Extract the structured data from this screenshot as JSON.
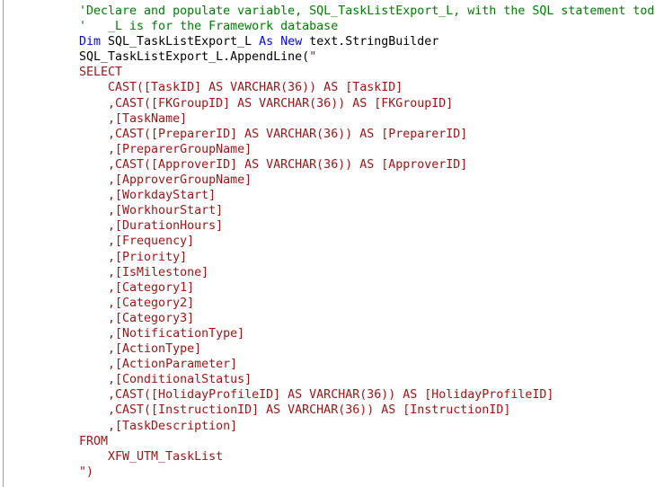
{
  "editor": {
    "language": "Visual Basic .NET",
    "background_color": "#ffffff",
    "margin_rule_color": "#9c9c9c",
    "colors": {
      "comment": "#008000",
      "keyword": "#0000ff",
      "identifier": "#000000",
      "string_literal": "#a31515"
    },
    "lines": [
      {
        "index": 1,
        "tokens": [
          {
            "type": "comment",
            "text": "'Declare and populate variable, SQL_TaskListExport_L, with the SQL statement today."
          }
        ]
      },
      {
        "index": 2,
        "tokens": [
          {
            "type": "comment",
            "text": "'   _L is for the Framework database"
          }
        ]
      },
      {
        "index": 3,
        "tokens": [
          {
            "type": "keyword",
            "text": "Dim"
          },
          {
            "type": "plain",
            "text": " SQL_TaskListExport_L "
          },
          {
            "type": "keyword",
            "text": "As"
          },
          {
            "type": "plain",
            "text": " "
          },
          {
            "type": "keyword",
            "text": "New"
          },
          {
            "type": "plain",
            "text": " text.StringBuilder"
          }
        ]
      },
      {
        "index": 4,
        "tokens": [
          {
            "type": "plain",
            "text": "SQL_TaskListExport_L.AppendLine("
          },
          {
            "type": "string",
            "text": "\""
          }
        ]
      },
      {
        "index": 5,
        "tokens": [
          {
            "type": "string",
            "text": "SELECT"
          }
        ]
      },
      {
        "index": 6,
        "tokens": [
          {
            "type": "string",
            "text": "    CAST([TaskID] AS VARCHAR(36)) AS [TaskID]"
          }
        ]
      },
      {
        "index": 7,
        "tokens": [
          {
            "type": "string",
            "text": "    ,CAST([FKGroupID] AS VARCHAR(36)) AS [FKGroupID]"
          }
        ]
      },
      {
        "index": 8,
        "tokens": [
          {
            "type": "string",
            "text": "    ,[TaskName]"
          }
        ]
      },
      {
        "index": 9,
        "tokens": [
          {
            "type": "string",
            "text": "    ,CAST([PreparerID] AS VARCHAR(36)) AS [PreparerID]"
          }
        ]
      },
      {
        "index": 10,
        "tokens": [
          {
            "type": "string",
            "text": "    ,[PreparerGroupName]"
          }
        ]
      },
      {
        "index": 11,
        "tokens": [
          {
            "type": "string",
            "text": "    ,CAST([ApproverID] AS VARCHAR(36)) AS [ApproverID]"
          }
        ]
      },
      {
        "index": 12,
        "tokens": [
          {
            "type": "string",
            "text": "    ,[ApproverGroupName]"
          }
        ]
      },
      {
        "index": 13,
        "tokens": [
          {
            "type": "string",
            "text": "    ,[WorkdayStart]"
          }
        ]
      },
      {
        "index": 14,
        "tokens": [
          {
            "type": "string",
            "text": "    ,[WorkhourStart]"
          }
        ]
      },
      {
        "index": 15,
        "tokens": [
          {
            "type": "string",
            "text": "    ,[DurationHours]"
          }
        ]
      },
      {
        "index": 16,
        "tokens": [
          {
            "type": "string",
            "text": "    ,[Frequency]"
          }
        ]
      },
      {
        "index": 17,
        "tokens": [
          {
            "type": "string",
            "text": "    ,[Priority]"
          }
        ]
      },
      {
        "index": 18,
        "tokens": [
          {
            "type": "string",
            "text": "    ,[IsMilestone]"
          }
        ]
      },
      {
        "index": 19,
        "tokens": [
          {
            "type": "string",
            "text": "    ,[Category1]"
          }
        ]
      },
      {
        "index": 20,
        "tokens": [
          {
            "type": "string",
            "text": "    ,[Category2]"
          }
        ]
      },
      {
        "index": 21,
        "tokens": [
          {
            "type": "string",
            "text": "    ,[Category3]"
          }
        ]
      },
      {
        "index": 22,
        "tokens": [
          {
            "type": "string",
            "text": "    ,[NotificationType]"
          }
        ]
      },
      {
        "index": 23,
        "tokens": [
          {
            "type": "string",
            "text": "    ,[ActionType]"
          }
        ]
      },
      {
        "index": 24,
        "tokens": [
          {
            "type": "string",
            "text": "    ,[ActionParameter]"
          }
        ]
      },
      {
        "index": 25,
        "tokens": [
          {
            "type": "string",
            "text": "    ,[ConditionalStatus]"
          }
        ]
      },
      {
        "index": 26,
        "tokens": [
          {
            "type": "string",
            "text": "    ,CAST([HolidayProfileID] AS VARCHAR(36)) AS [HolidayProfileID]"
          }
        ]
      },
      {
        "index": 27,
        "tokens": [
          {
            "type": "string",
            "text": "    ,CAST([InstructionID] AS VARCHAR(36)) AS [InstructionID]"
          }
        ]
      },
      {
        "index": 28,
        "tokens": [
          {
            "type": "string",
            "text": "    ,[TaskDescription]"
          }
        ]
      },
      {
        "index": 29,
        "tokens": [
          {
            "type": "string",
            "text": "FROM"
          }
        ]
      },
      {
        "index": 30,
        "tokens": [
          {
            "type": "string",
            "text": "    XFW_UTM_TaskList"
          }
        ]
      },
      {
        "index": 31,
        "tokens": [
          {
            "type": "string",
            "text": "\")"
          }
        ]
      }
    ]
  }
}
